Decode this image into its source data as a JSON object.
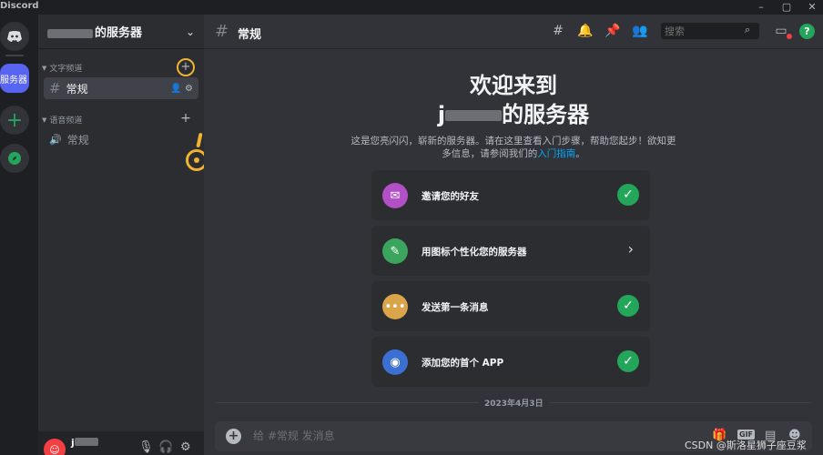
{
  "app": {
    "brand": "Discord",
    "window_controls": [
      "–",
      "▢",
      "✕"
    ]
  },
  "rail": {
    "home_icon": "discord-logo-icon",
    "server_label": "的服务器",
    "add_icon": "plus-icon",
    "explore_icon": "compass-icon"
  },
  "sidebar": {
    "server_name": "的服务器",
    "chevron": "⌄",
    "categories": [
      {
        "label": "文字频道",
        "add": "+"
      },
      {
        "label": "语音频道",
        "add": "+"
      }
    ],
    "channels": [
      {
        "label": "常规",
        "type": "text",
        "icon": "#"
      },
      {
        "label": "常规",
        "type": "voice",
        "icon": "🔊"
      }
    ]
  },
  "user": {
    "name": "j",
    "avatar_glyph": "☺"
  },
  "header": {
    "channel_icon": "#",
    "channel_name": "常规",
    "search_placeholder": "搜索",
    "help_glyph": "?"
  },
  "welcome": {
    "title_line1": "欢迎来到",
    "title_line2": "的服务器",
    "prefix": "j",
    "desc_prefix": "这是您亮闪闪，崭新的服务器。请在这里查看入门步骤，帮助您起步！欲知更多信息，请参阅我们的",
    "desc_link": "入门指南",
    "desc_suffix": "。"
  },
  "cards": [
    {
      "label": "邀请您的好友",
      "icon": "invite-friends-icon",
      "status": "done",
      "color": "#b34fc7"
    },
    {
      "label": "用图标个性化您的服务器",
      "icon": "personalize-icon",
      "status": "todo",
      "color": "#3ba55d"
    },
    {
      "label": "发送第一条消息",
      "icon": "send-message-icon",
      "status": "done",
      "color": "#d9a44a"
    },
    {
      "label": "添加您的首个 APP",
      "icon": "add-app-icon",
      "status": "done",
      "color": "#3b6fd1"
    }
  ],
  "check_glyph": "✓",
  "arrow_glyph": "›",
  "date_divider": "2023年4月3日",
  "composer": {
    "placeholder": "给 #常规 发消息",
    "gif": "GIF"
  },
  "watermark": "CSDN @斯洛星狮子座豆浆",
  "colors": {
    "blurple": "#5865f2",
    "green": "#23a55a",
    "link": "#00a8fc",
    "highlight": "#f0b232"
  }
}
